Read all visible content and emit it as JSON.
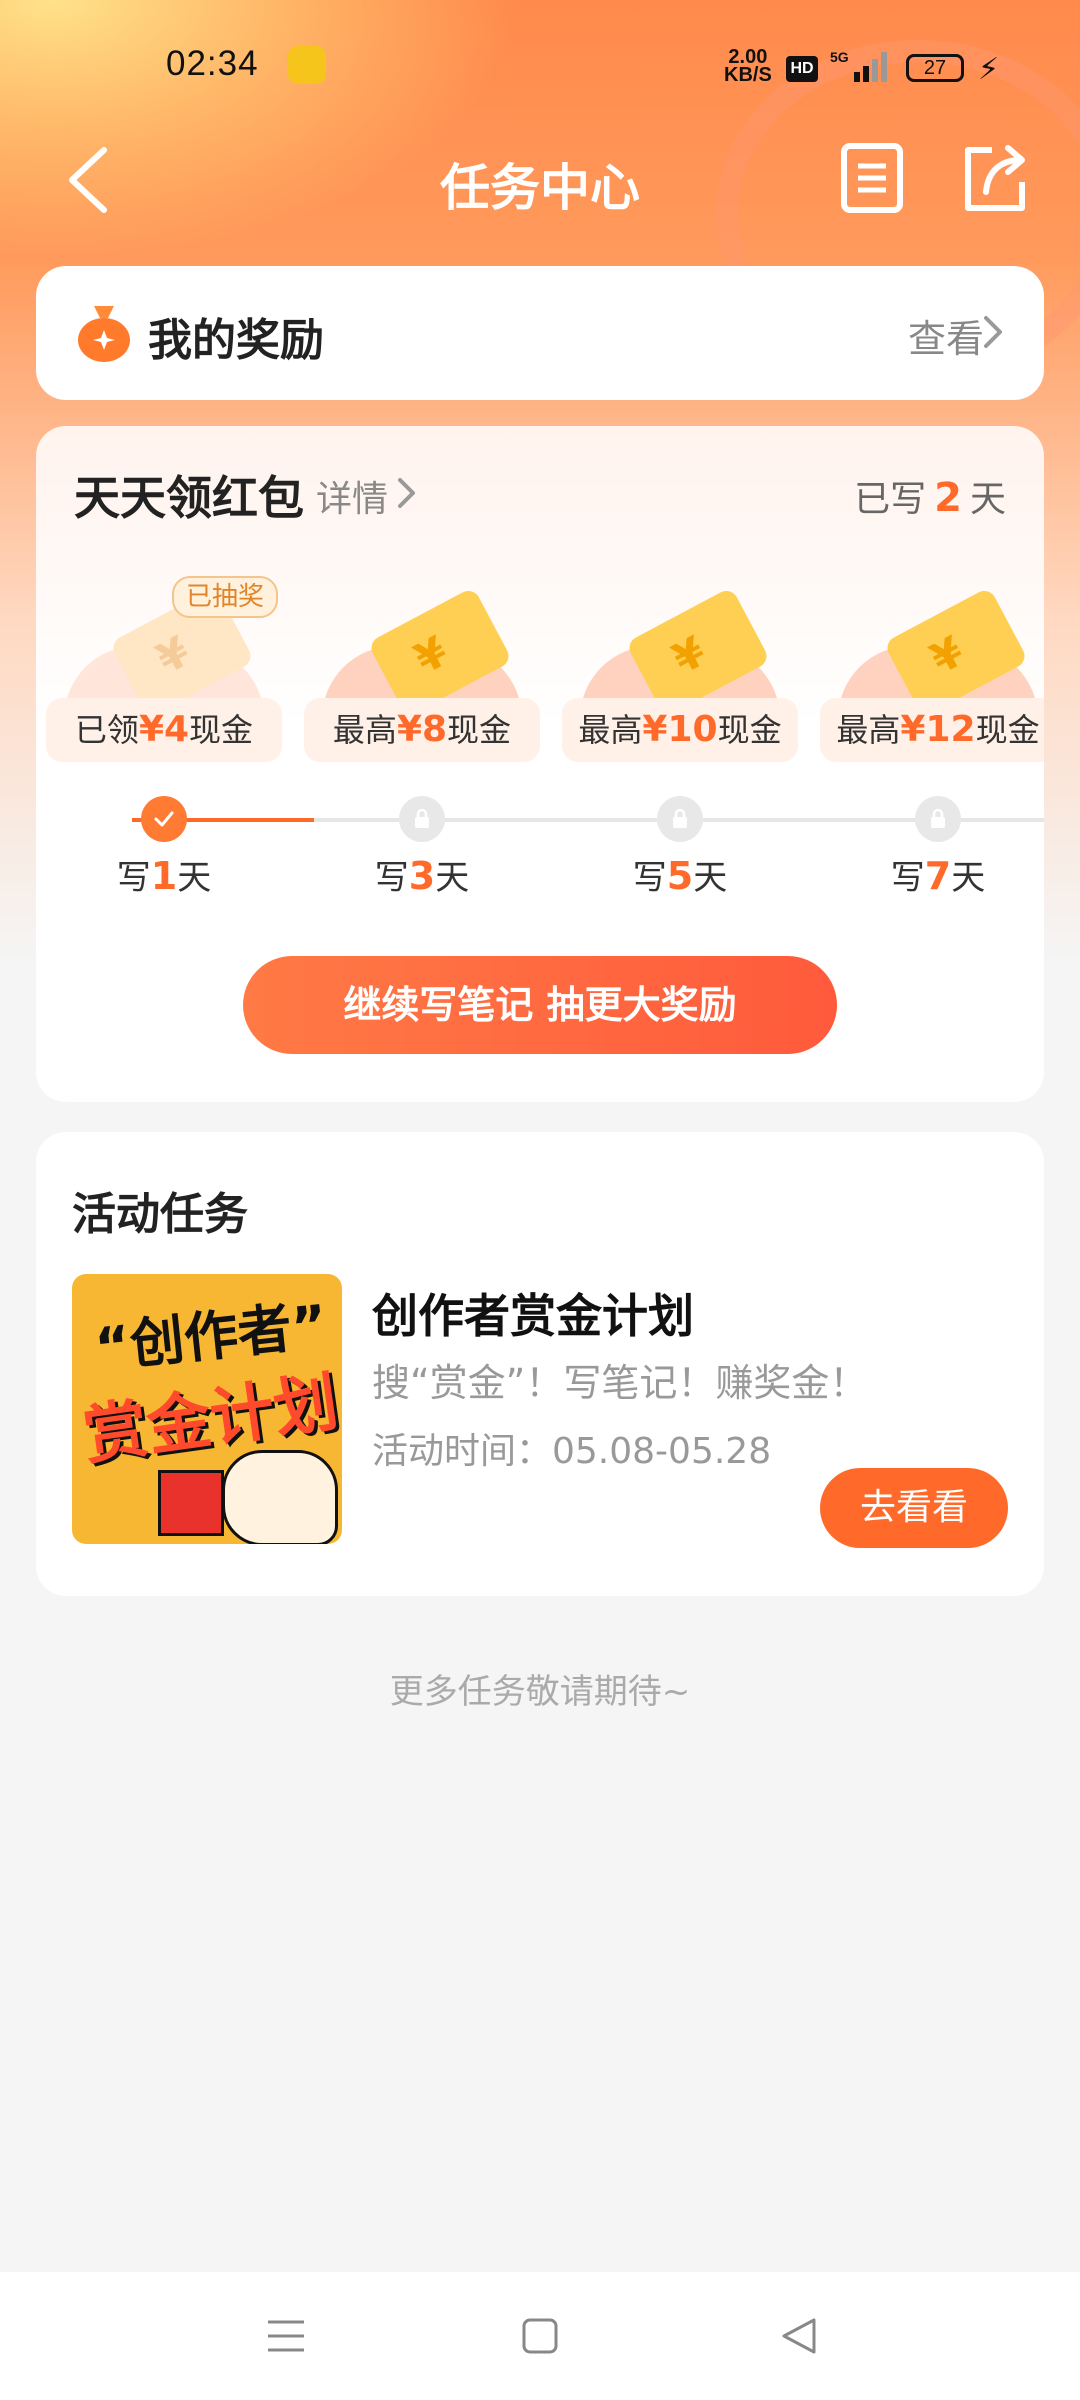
{
  "status_bar": {
    "time": "02:34",
    "net_speed_value": "2.00",
    "net_speed_unit": "KB/S",
    "hd": "HD",
    "network": "5G",
    "battery": "27"
  },
  "navbar": {
    "title": "任务中心",
    "icons": [
      "back-icon",
      "list-icon",
      "share-icon"
    ]
  },
  "my_rewards": {
    "label": "我的奖励",
    "view": "查看"
  },
  "daily": {
    "title": "天天领红包",
    "detail": "详情",
    "written_prefix": "已写",
    "written_days": "2",
    "written_suffix": "天",
    "slots": [
      {
        "badge": "已抽奖",
        "prefix": "已领",
        "amount": "¥4",
        "suffix": "现金",
        "day_prefix": "写",
        "day": "1",
        "day_suffix": "天",
        "state": "done"
      },
      {
        "prefix": "最高",
        "amount": "¥8",
        "suffix": "现金",
        "day_prefix": "写",
        "day": "3",
        "day_suffix": "天",
        "state": "locked"
      },
      {
        "prefix": "最高",
        "amount": "¥10",
        "suffix": "现金",
        "day_prefix": "写",
        "day": "5",
        "day_suffix": "天",
        "state": "locked"
      },
      {
        "prefix": "最高",
        "amount": "¥12",
        "suffix": "现金",
        "day_prefix": "写",
        "day": "7",
        "day_suffix": "天",
        "state": "locked"
      }
    ],
    "cta": "继续写笔记 抽更大奖励"
  },
  "activity": {
    "title": "活动任务",
    "thumb_line1": "“创作者”",
    "thumb_line2": "赏金计划",
    "name": "创作者赏金计划",
    "desc": "搜“赏金”！写笔记！赚奖金！",
    "time": "活动时间：05.08-05.28",
    "button": "去看看"
  },
  "footer_note": "更多任务敬请期待~",
  "colors": {
    "accent": "#ff6a2b",
    "header_gradient_start": "#ff8a4c"
  }
}
